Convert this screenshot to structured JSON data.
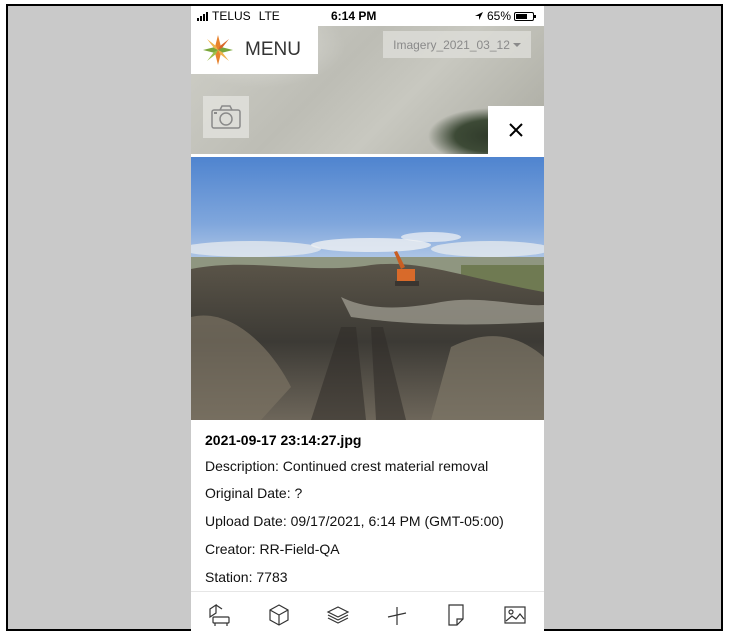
{
  "status_bar": {
    "carrier": "TELUS",
    "network": "LTE",
    "time": "6:14 PM",
    "battery": "65%",
    "battery_level": 0.65
  },
  "map": {
    "menu_label": "MENU",
    "imagery_select": "Imagery_2021_03_12",
    "icons": [
      "logo-icon",
      "camera-icon",
      "close-icon",
      "chevron-down-icon"
    ]
  },
  "photo_info": {
    "filename": "2021-09-17 23:14:27.jpg",
    "description": "Description: Continued crest material removal",
    "original_date": "Original Date: ?",
    "upload_date": "Upload Date: 09/17/2021, 6:14 PM (GMT-05:00)",
    "creator": "Creator: RR-Field-QA",
    "station": "Station: 7783"
  },
  "toolbar": {
    "items": [
      "survey-icon",
      "cube-icon",
      "layers-icon",
      "measure-icon",
      "document-icon",
      "image-icon"
    ]
  },
  "colors": {
    "sky": "#5f8fd1",
    "frame_bg": "#c9c9c9",
    "logo_orange": "#e8822c",
    "logo_green": "#7aa63a"
  }
}
